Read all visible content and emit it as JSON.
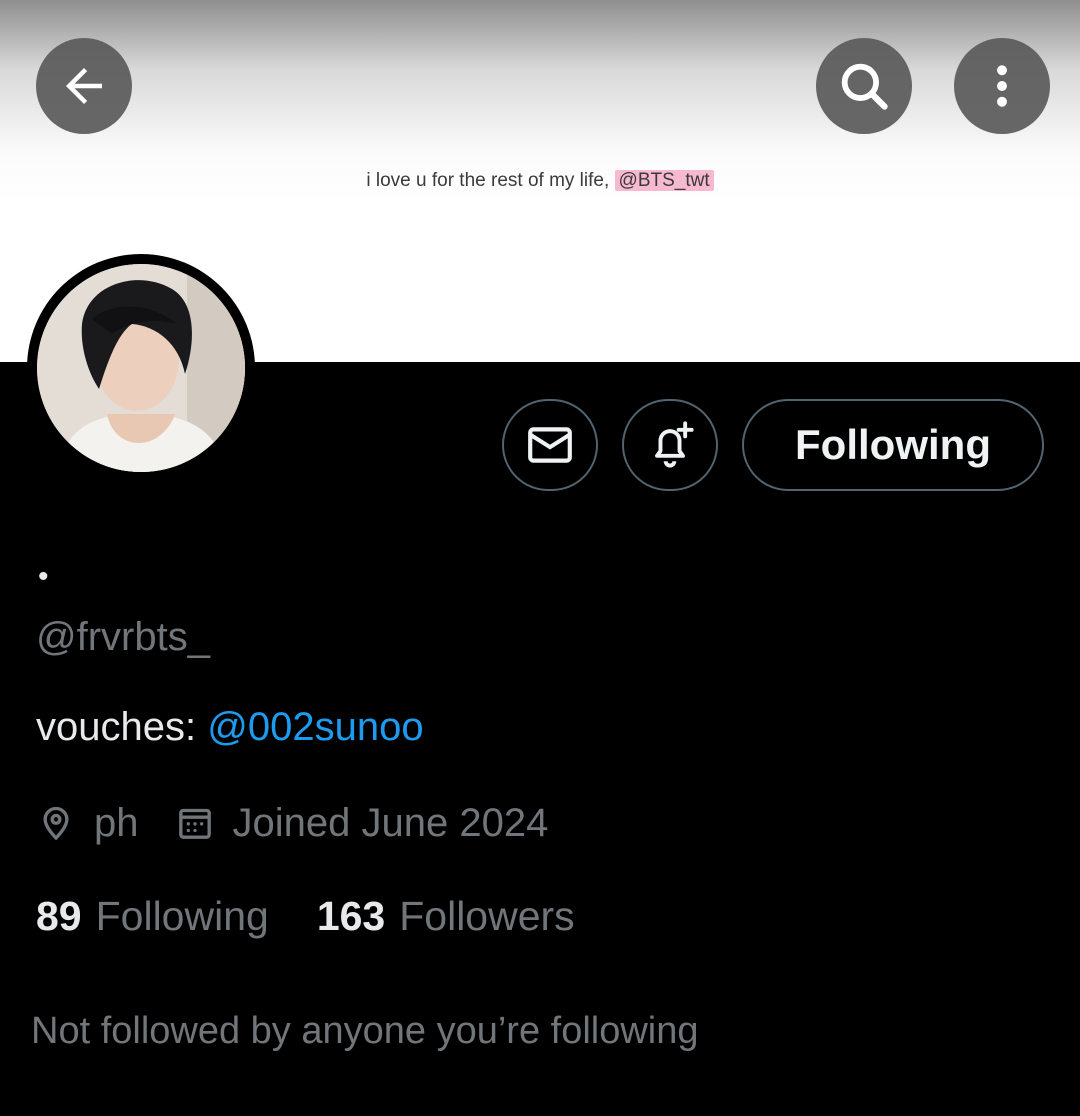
{
  "banner": {
    "text": "i love u for the rest of my life,",
    "mention": "@BTS_twt"
  },
  "nav": {
    "back_icon": "arrow-left-icon",
    "search_icon": "search-icon",
    "more_icon": "more-vertical-icon"
  },
  "actions": {
    "following_label": "Following"
  },
  "profile": {
    "display_name": "•",
    "handle": "@frvrbts_",
    "bio_prefix": "vouches:",
    "bio_link": "@002sunoo",
    "location": "ph",
    "joined": "Joined June 2024"
  },
  "stats": {
    "following_count": "89",
    "following_label": "Following",
    "followers_count": "163",
    "followers_label": "Followers"
  },
  "not_followed_text": "Not followed by anyone you’re following",
  "colors": {
    "accent": "#1d9bf0",
    "muted": "#71767b",
    "mention_highlight": "#f6b9cf"
  }
}
